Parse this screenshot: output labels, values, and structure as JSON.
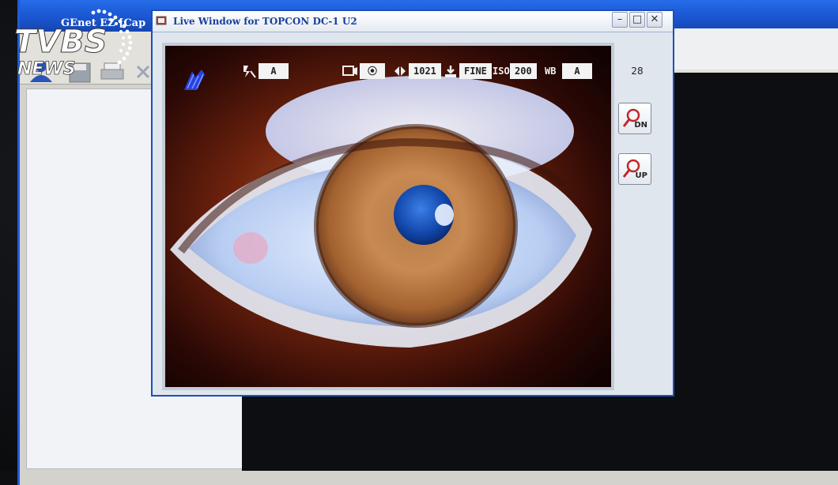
{
  "parent_window": {
    "title": "GEnet EZ [Cap"
  },
  "live_window": {
    "title": "Live Window for TOPCON DC-1 U2",
    "min_glyph": "–",
    "max_glyph": "□",
    "close_glyph": "✕"
  },
  "osd": {
    "flash_value": "A",
    "quality_value": "1021",
    "image_quality": "FINE",
    "iso_label": "ISO",
    "iso_value": "200",
    "wb_label": "WB",
    "wb_value": "A"
  },
  "side_panel": {
    "frame_number": "28",
    "zoom_down_label": "DN",
    "zoom_up_label": "UP"
  },
  "watermark": {
    "brand": "TVBS",
    "sub": "NEWS"
  },
  "icons": {
    "zoom_down": "magnifier-icon",
    "zoom_up": "magnifier-icon",
    "app": "camera-app-icon"
  }
}
